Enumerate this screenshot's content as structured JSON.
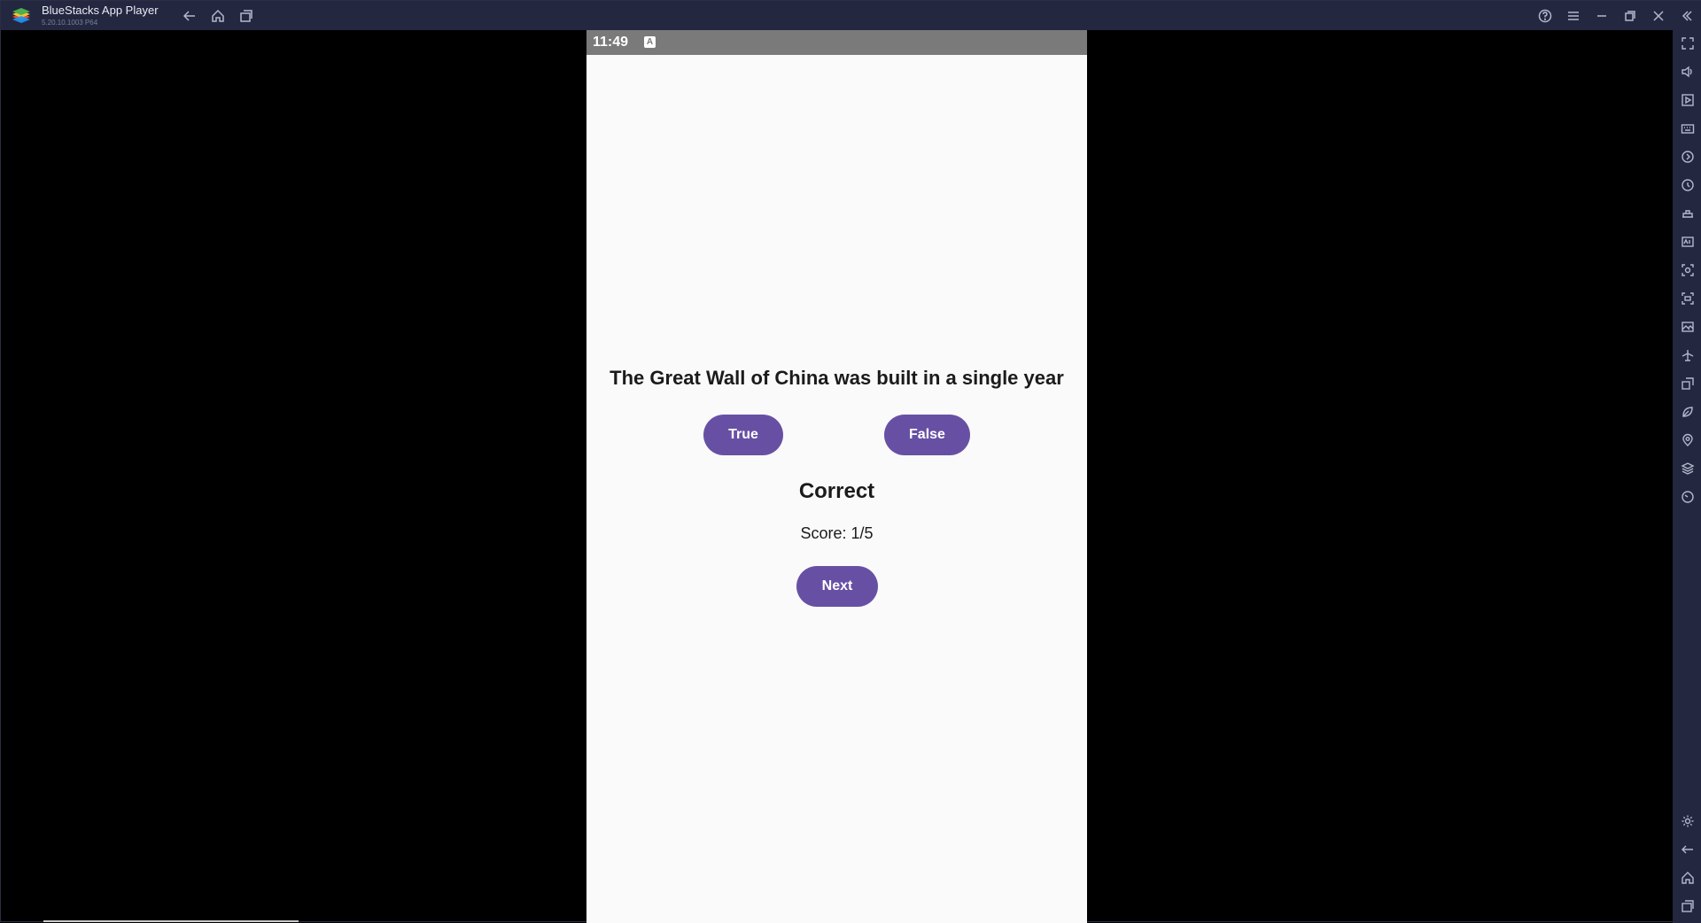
{
  "titlebar": {
    "app_title": "BlueStacks App Player",
    "app_version": "5.20.10.1003 P64",
    "icons": [
      "back-icon",
      "home-icon",
      "recents-icon",
      "help-icon",
      "menu-icon",
      "minimize-icon",
      "restore-icon",
      "close-icon",
      "collapse-sidebar-icon"
    ]
  },
  "sidebar": {
    "icons": [
      "fullscreen-icon",
      "volume-icon",
      "media-icon",
      "keyboard-icon",
      "rotate-icon",
      "sync-icon",
      "macro-icon",
      "multi-instance-icon",
      "screenshot-icon",
      "record-icon",
      "gallery-icon",
      "airplane-icon",
      "resize-icon",
      "eco-mode-icon",
      "location-icon",
      "layers-icon",
      "speed-icon",
      "settings-icon",
      "back-icon",
      "home-icon",
      "recents-icon"
    ]
  },
  "status_bar": {
    "time": "11:49",
    "notification": "A"
  },
  "quiz": {
    "question": "The Great Wall of China was built in a single year",
    "true_label": "True",
    "false_label": "False",
    "result": "Correct",
    "score": "Score: 1/5",
    "next_label": "Next"
  },
  "colors": {
    "accent": "#6750a4",
    "titlebar_bg": "#232740",
    "status_bar_bg": "#7a7a7a",
    "screen_bg": "#fafafa"
  }
}
